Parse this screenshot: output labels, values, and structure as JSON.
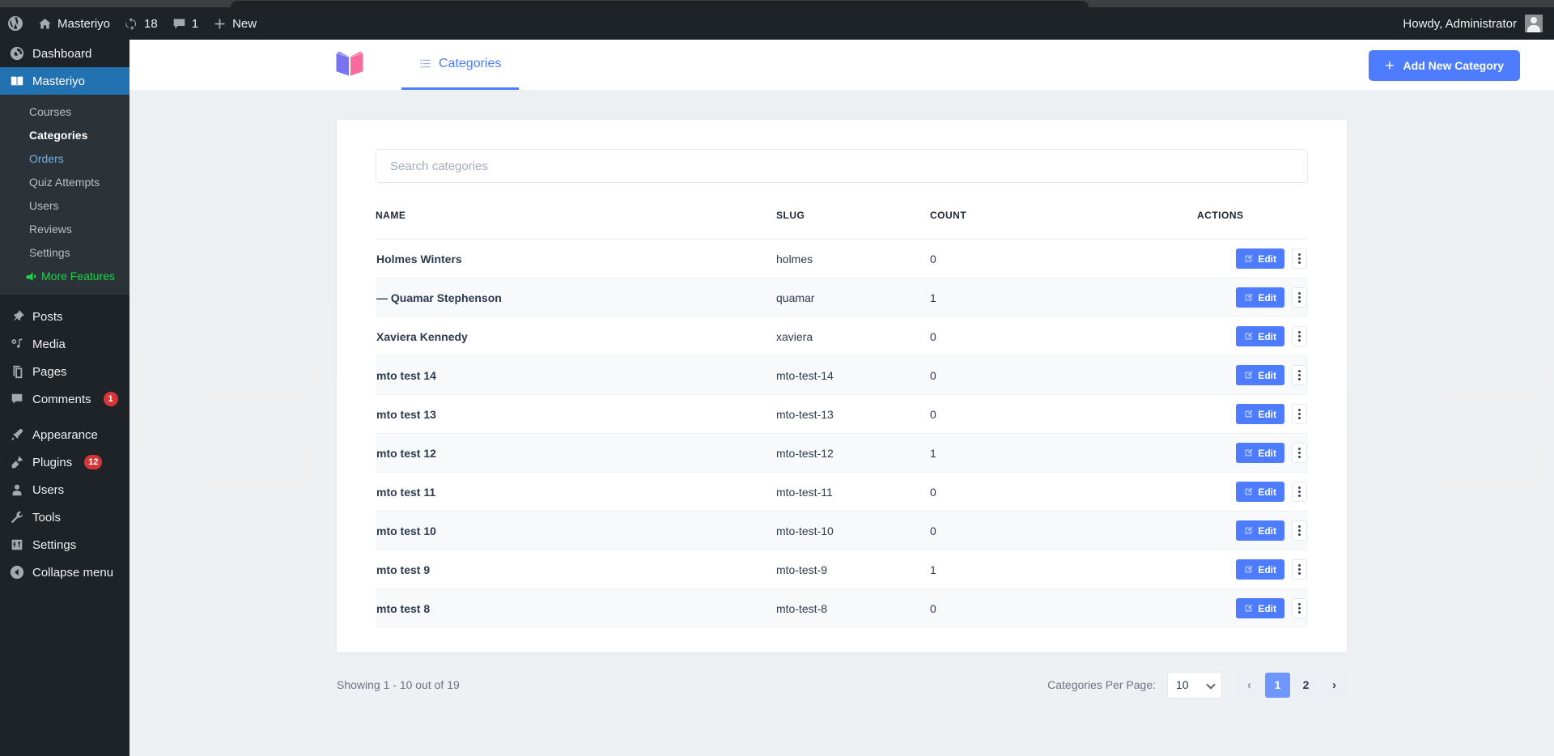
{
  "adminbar": {
    "wp_logo": "wordpress-logo",
    "site_name": "Masteriyo",
    "updates_count": "18",
    "comments_count": "1",
    "new_label": "New",
    "howdy": "Howdy, Administrator"
  },
  "sidebar": {
    "dashboard": "Dashboard",
    "masteriyo": "Masteriyo",
    "submenu": [
      {
        "label": "Courses",
        "state": "normal"
      },
      {
        "label": "Categories",
        "state": "current"
      },
      {
        "label": "Orders",
        "state": "hovered"
      },
      {
        "label": "Quiz Attempts",
        "state": "normal"
      },
      {
        "label": "Users",
        "state": "normal"
      },
      {
        "label": "Reviews",
        "state": "normal"
      },
      {
        "label": "Settings",
        "state": "normal"
      },
      {
        "label": "More Features",
        "state": "promo"
      }
    ],
    "items": [
      {
        "label": "Posts",
        "icon": "pin-icon",
        "badge": ""
      },
      {
        "label": "Media",
        "icon": "media-icon",
        "badge": ""
      },
      {
        "label": "Pages",
        "icon": "pages-icon",
        "badge": ""
      },
      {
        "label": "Comments",
        "icon": "comment-icon",
        "badge": "1"
      },
      {
        "label": "Appearance",
        "icon": "brush-icon",
        "badge": ""
      },
      {
        "label": "Plugins",
        "icon": "plug-icon",
        "badge": "12"
      },
      {
        "label": "Users",
        "icon": "user-icon",
        "badge": ""
      },
      {
        "label": "Tools",
        "icon": "wrench-icon",
        "badge": ""
      },
      {
        "label": "Settings",
        "icon": "sliders-icon",
        "badge": ""
      },
      {
        "label": "Collapse menu",
        "icon": "collapse-icon",
        "badge": ""
      }
    ]
  },
  "header": {
    "logo": "masteriyo-book-logo",
    "tab_label": "Categories",
    "add_button": "Add New Category",
    "plus": "+"
  },
  "search": {
    "placeholder": "Search categories",
    "value": ""
  },
  "table": {
    "columns": [
      "NAME",
      "SLUG",
      "COUNT",
      "ACTIONS"
    ],
    "edit_label": "Edit",
    "rows": [
      {
        "name": "Holmes Winters",
        "slug": "holmes",
        "count": "0"
      },
      {
        "name": "— Quamar Stephenson",
        "slug": "quamar",
        "count": "1"
      },
      {
        "name": "Xaviera Kennedy",
        "slug": "xaviera",
        "count": "0"
      },
      {
        "name": "mto test 14",
        "slug": "mto-test-14",
        "count": "0"
      },
      {
        "name": "mto test 13",
        "slug": "mto-test-13",
        "count": "0"
      },
      {
        "name": "mto test 12",
        "slug": "mto-test-12",
        "count": "1"
      },
      {
        "name": "mto test 11",
        "slug": "mto-test-11",
        "count": "0"
      },
      {
        "name": "mto test 10",
        "slug": "mto-test-10",
        "count": "0"
      },
      {
        "name": "mto test 9",
        "slug": "mto-test-9",
        "count": "1"
      },
      {
        "name": "mto test 8",
        "slug": "mto-test-8",
        "count": "0"
      }
    ]
  },
  "footer": {
    "showing": "Showing 1 - 10 out of 19",
    "per_page_label": "Categories Per Page:",
    "per_page_value": "10",
    "prev": "‹",
    "next": "›",
    "pages": [
      "1",
      "2"
    ],
    "active_page": "1"
  },
  "colors": {
    "accent": "#4d7cfe",
    "wp_admin_dark": "#1d2327",
    "wp_current_blue": "#2271b1",
    "badge_red": "#d63638",
    "promo_green": "#1ed14b",
    "page_bg": "#eceff1"
  }
}
